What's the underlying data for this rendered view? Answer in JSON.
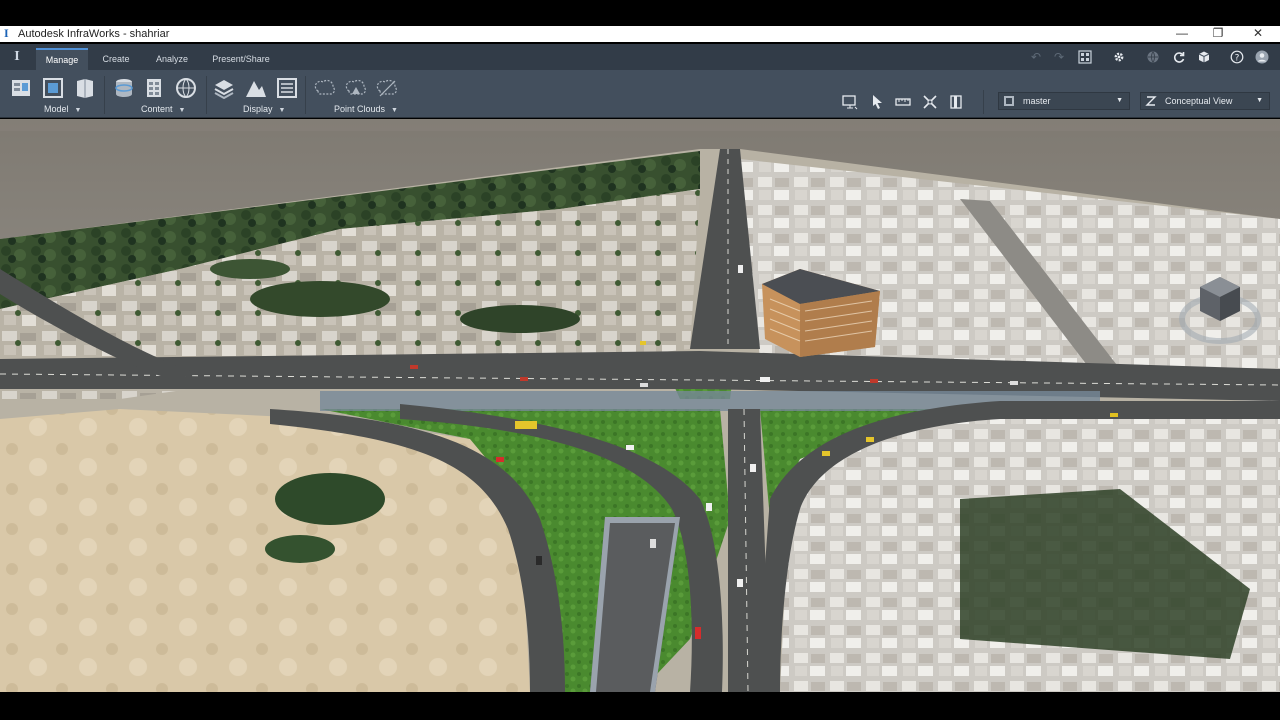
{
  "window": {
    "title": "Autodesk InfraWorks - shahriar",
    "minimize_glyph": "—",
    "maximize_glyph": "❐",
    "close_glyph": "✕"
  },
  "tabs": [
    {
      "label": "Manage",
      "active": true
    },
    {
      "label": "Create",
      "active": false
    },
    {
      "label": "Analyze",
      "active": false
    },
    {
      "label": "Present/Share",
      "active": false
    }
  ],
  "quick_access_icons": [
    "undo-icon",
    "redo-icon",
    "model-grid-icon",
    "settings-gear-icon",
    "globe-icon",
    "sync-icon",
    "cube-icon",
    "help-icon",
    "user-avatar-icon"
  ],
  "ribbon": {
    "groups": [
      {
        "label": "Model",
        "icons": [
          "data-sources-icon",
          "model-properties-icon",
          "model-explorer-icon"
        ]
      },
      {
        "label": "Content",
        "icons": [
          "database-icon",
          "style-palette-icon",
          "globe-network-icon"
        ]
      },
      {
        "label": "Display",
        "icons": [
          "layers-icon",
          "terrain-icon",
          "list-panel-icon"
        ]
      },
      {
        "label": "Point Clouds",
        "icons": [
          "point-cloud-icon",
          "point-cloud-terrain-icon",
          "point-cloud-slice-icon"
        ]
      }
    ],
    "tools": [
      "screen-capture-icon",
      "select-cursor-icon",
      "measure-icon",
      "snap-tool-icon",
      "bookmark-panel-icon"
    ],
    "proposal_dropdown": {
      "value": "master",
      "icon": "proposal-icon"
    },
    "view_dropdown": {
      "value": "Conceptual View",
      "icon": "visual-style-icon"
    }
  },
  "viewport": {
    "scene": "3d-model-interchange",
    "building_color": "#c7925c",
    "road_color": "#4e5050",
    "grass_color": "#4a8a2f"
  },
  "colors": {
    "title_bar": "#ffffff",
    "tab_bar": "#323c48",
    "ribbon": "#434f5d",
    "accent": "#4f8fd6"
  }
}
